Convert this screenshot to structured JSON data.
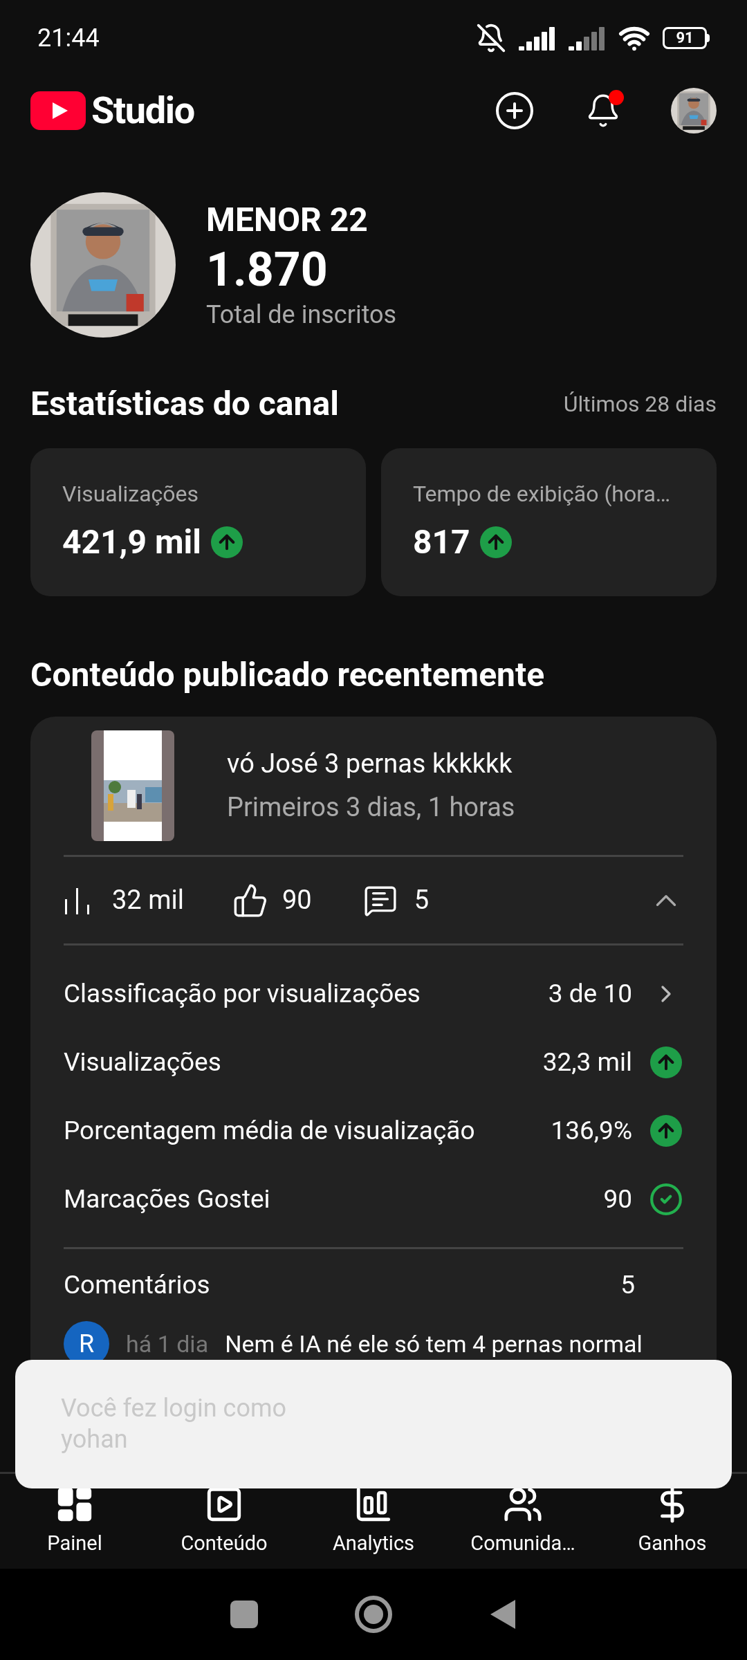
{
  "status_bar": {
    "time": "21:44",
    "battery": "91"
  },
  "header": {
    "logo_text": "Studio",
    "notification_dot": true
  },
  "channel": {
    "name": "MENOR 22",
    "subscribers": "1.870",
    "subscribers_label": "Total de inscritos"
  },
  "stats": {
    "title": "Estatísticas do canal",
    "period": "Últimos 28 dias",
    "cards": [
      {
        "label": "Visualizações",
        "value": "421,9 mil",
        "trend_up": true
      },
      {
        "label": "Tempo de exibição (hora…",
        "value": "817",
        "trend_up": true
      }
    ]
  },
  "recent": {
    "title": "Conteúdo publicado recentemente",
    "video": {
      "title": "vó José 3 pernas kkkkkk",
      "period": "Primeiros 3 dias, 1 horas"
    },
    "summary": {
      "views": "32 mil",
      "likes": "90",
      "comments": "5",
      "expanded": true
    },
    "metrics": [
      {
        "label": "Classificação por visualizações",
        "value": "3 de 10",
        "kind": "link"
      },
      {
        "label": "Visualizações",
        "value": "32,3 mil",
        "kind": "trend_up"
      },
      {
        "label": "Porcentagem média de visualização",
        "value": "136,9%",
        "kind": "trend_up"
      },
      {
        "label": "Marcações Gostei",
        "value": "90",
        "kind": "check"
      }
    ],
    "comments": {
      "label": "Comentários",
      "count": "5",
      "latest": {
        "initial": "R",
        "time": "há 1 dia",
        "text": "Nem é IA né ele só tem 4 pernas normal"
      }
    }
  },
  "toast": {
    "text": "Você fez login como yohan"
  },
  "bottom_nav": [
    {
      "label": "Painel",
      "kind": "dashboard"
    },
    {
      "label": "Conteúdo",
      "kind": "content"
    },
    {
      "label": "Analytics",
      "kind": "analytics"
    },
    {
      "label": "Comunida…",
      "kind": "community"
    },
    {
      "label": "Ganhos",
      "kind": "earnings"
    }
  ]
}
